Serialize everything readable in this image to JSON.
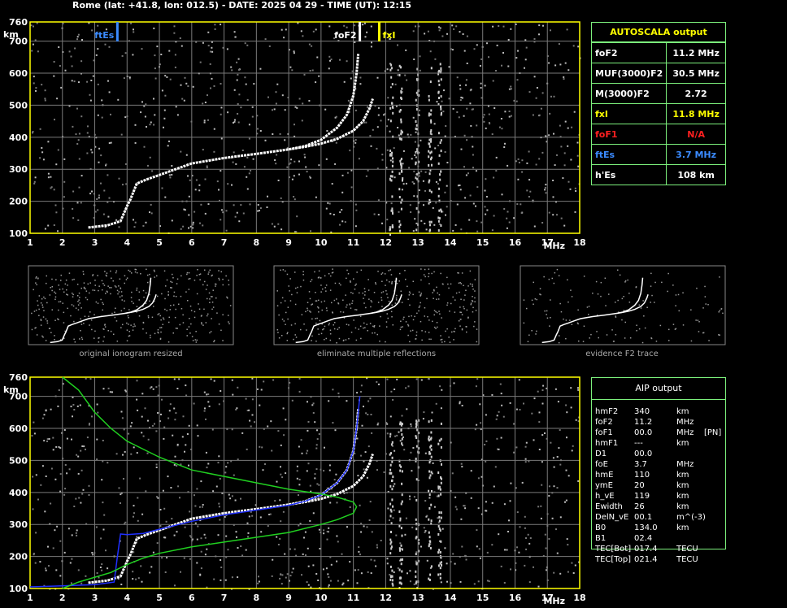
{
  "header": {
    "title": "Rome (lat: +41.8, lon: 012.5) - DATE: 2025 04 29 - TIME (UT): 12:15"
  },
  "autoscala": {
    "title": "AUTOSCALA output",
    "rows": [
      {
        "label": "foF2",
        "value": "11.2 MHz",
        "color": "#ffffff"
      },
      {
        "label": "MUF(3000)F2",
        "value": "30.5 MHz",
        "color": "#ffffff"
      },
      {
        "label": "M(3000)F2",
        "value": "2.72",
        "color": "#ffffff"
      },
      {
        "label": "fxI",
        "value": "11.8 MHz",
        "color": "#ffff00"
      },
      {
        "label": "foF1",
        "value": "N/A",
        "color": "#ff2020"
      },
      {
        "label": "ftEs",
        "value": "3.7 MHz",
        "color": "#3b8bff"
      },
      {
        "label": "h'Es",
        "value": "108    km",
        "color": "#ffffff"
      }
    ]
  },
  "aip": {
    "title": "AIP output",
    "rows": [
      {
        "name": "hmF2",
        "value": "340",
        "unit": "km",
        "extra": ""
      },
      {
        "name": "foF2",
        "value": "11.2",
        "unit": "MHz",
        "extra": ""
      },
      {
        "name": "foF1",
        "value": "00.0",
        "unit": "MHz",
        "extra": "[PN]"
      },
      {
        "name": "hmF1",
        "value": "---",
        "unit": "km",
        "extra": ""
      },
      {
        "name": "D1",
        "value": "00.0",
        "unit": "",
        "extra": ""
      },
      {
        "name": "foE",
        "value": "3.7",
        "unit": "MHz",
        "extra": ""
      },
      {
        "name": "hmE",
        "value": "110",
        "unit": "km",
        "extra": ""
      },
      {
        "name": "ymE",
        "value": "20",
        "unit": "km",
        "extra": ""
      },
      {
        "name": "h_vE",
        "value": "119",
        "unit": "km",
        "extra": ""
      },
      {
        "name": "Ewidth",
        "value": "26",
        "unit": "km",
        "extra": ""
      },
      {
        "name": "DelN_vE",
        "value": "00.1",
        "unit": "m^(-3)",
        "extra": ""
      },
      {
        "name": "B0",
        "value": "134.0",
        "unit": "km",
        "extra": ""
      },
      {
        "name": "B1",
        "value": "02.4",
        "unit": "",
        "extra": ""
      },
      {
        "name": "TEC[Bot]",
        "value": "017.4",
        "unit": "TECU",
        "extra": ""
      },
      {
        "name": "TEC[Top]",
        "value": "021.4",
        "unit": "TECU",
        "extra": ""
      }
    ]
  },
  "thumbnails": {
    "captions": [
      "original ionogram resized",
      "eliminate multiple reflections",
      "evidence F2 trace"
    ]
  },
  "chart_data": [
    {
      "type": "scatter",
      "name": "ionogram-autoscala",
      "xlim": [
        1,
        18
      ],
      "ylim": [
        100,
        760
      ],
      "xlabel": "MHz",
      "ylabel": "km",
      "xticks": [
        1,
        2,
        3,
        4,
        5,
        6,
        7,
        8,
        9,
        10,
        11,
        12,
        13,
        14,
        15,
        16,
        17,
        18
      ],
      "yticks": [
        100,
        200,
        300,
        400,
        500,
        600,
        700,
        760
      ],
      "grid": true,
      "markers": [
        {
          "label": "ftEs",
          "x": 3.7,
          "color": "#3b8bff"
        },
        {
          "label": "foF2",
          "x": 11.2,
          "color": "#ffffff"
        },
        {
          "label": "fxI",
          "x": 11.8,
          "color": "#ffff00"
        }
      ],
      "series": [
        {
          "name": "o-trace",
          "color": "#ffffff",
          "x": [
            2.8,
            3.4,
            3.8,
            4.0,
            4.1,
            4.3,
            4.6,
            5.0,
            5.5,
            6.0,
            7.0,
            8.0,
            9.0,
            9.5,
            10.0,
            10.5,
            10.8,
            11.0,
            11.1,
            11.15
          ],
          "y": [
            118,
            125,
            138,
            185,
            205,
            255,
            268,
            282,
            300,
            318,
            335,
            348,
            362,
            372,
            392,
            430,
            470,
            530,
            600,
            660
          ]
        },
        {
          "name": "x-trace",
          "color": "#ffffff",
          "x": [
            9.0,
            9.5,
            10.0,
            10.5,
            11.0,
            11.3,
            11.5,
            11.6
          ],
          "y": [
            362,
            370,
            380,
            395,
            420,
            450,
            490,
            520
          ]
        }
      ]
    },
    {
      "type": "line",
      "name": "ionogram-aip",
      "xlim": [
        1,
        18
      ],
      "ylim": [
        100,
        760
      ],
      "xlabel": "MHz",
      "ylabel": "km",
      "xticks": [
        1,
        2,
        3,
        4,
        5,
        6,
        7,
        8,
        9,
        10,
        11,
        12,
        13,
        14,
        15,
        16,
        17,
        18
      ],
      "yticks": [
        100,
        200,
        300,
        400,
        500,
        600,
        700,
        760
      ],
      "grid": true,
      "series": [
        {
          "name": "recorded-trace",
          "color": "#ffffff",
          "x": [
            2.8,
            3.4,
            3.8,
            4.0,
            4.1,
            4.3,
            4.6,
            5.0,
            5.5,
            6.0,
            7.0,
            8.0,
            9.0,
            9.5,
            10.0,
            10.5,
            10.8,
            11.0,
            11.1,
            11.15
          ],
          "y": [
            118,
            125,
            138,
            185,
            205,
            255,
            268,
            282,
            300,
            318,
            335,
            348,
            362,
            372,
            392,
            430,
            470,
            530,
            600,
            660
          ]
        },
        {
          "name": "recorded-x-trace",
          "color": "#ffffff",
          "x": [
            9.0,
            9.5,
            10.0,
            10.5,
            11.0,
            11.3,
            11.5,
            11.6
          ],
          "y": [
            362,
            370,
            380,
            395,
            420,
            450,
            490,
            520
          ]
        },
        {
          "name": "synthesized-trace",
          "color": "#2030ff",
          "x": [
            1.0,
            2.0,
            3.0,
            3.6,
            3.7,
            3.8,
            4.0,
            4.5,
            5.0,
            6.0,
            7.0,
            8.0,
            9.0,
            9.5,
            10.0,
            10.5,
            10.8,
            11.0,
            11.1,
            11.2
          ],
          "y": [
            105,
            108,
            112,
            120,
            200,
            270,
            268,
            272,
            285,
            310,
            330,
            345,
            360,
            372,
            392,
            430,
            470,
            530,
            600,
            700
          ]
        },
        {
          "name": "electron-density-profile",
          "color": "#20d020",
          "x": [
            2.0,
            2.5,
            3.0,
            3.5,
            4.0,
            4.5,
            5.0,
            6.0,
            7.0,
            8.0,
            9.0,
            10.0,
            10.5,
            11.0,
            11.1,
            11.0,
            10.5,
            10.0,
            9.0,
            8.0,
            7.0,
            6.0,
            5.0,
            4.0,
            3.5,
            3.0,
            2.5,
            2.0
          ],
          "y": [
            100,
            120,
            135,
            150,
            175,
            195,
            210,
            230,
            245,
            260,
            275,
            300,
            315,
            335,
            355,
            370,
            385,
            395,
            410,
            430,
            450,
            470,
            510,
            560,
            600,
            650,
            720,
            760
          ]
        }
      ]
    }
  ]
}
